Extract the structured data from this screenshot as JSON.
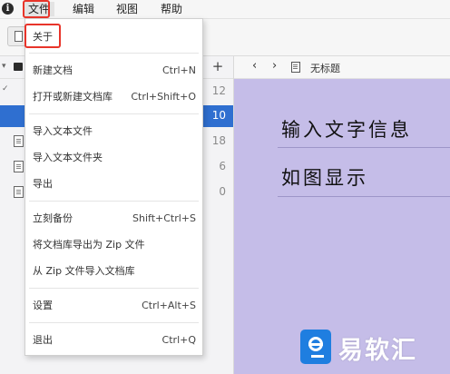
{
  "menubar": {
    "app_icon": "app-logo-icon",
    "items": [
      {
        "label": "文件",
        "active": true
      },
      {
        "label": "编辑",
        "active": false
      },
      {
        "label": "视图",
        "active": false
      },
      {
        "label": "帮助",
        "active": false
      }
    ]
  },
  "file_menu": {
    "items": [
      {
        "label": "关于",
        "shortcut": ""
      },
      {
        "label": "新建文档",
        "shortcut": "Ctrl+N"
      },
      {
        "label": "打开或新建文档库",
        "shortcut": "Ctrl+Shift+O"
      },
      {
        "label": "导入文本文件",
        "shortcut": ""
      },
      {
        "label": "导入文本文件夹",
        "shortcut": ""
      },
      {
        "label": "导出",
        "shortcut": ""
      },
      {
        "label": "立刻备份",
        "shortcut": "Shift+Ctrl+S"
      },
      {
        "label": "将文档库导出为 Zip 文件",
        "shortcut": ""
      },
      {
        "label": "从 Zip 文件导入文档库",
        "shortcut": ""
      },
      {
        "label": "设置",
        "shortcut": "Ctrl+Alt+S"
      },
      {
        "label": "退出",
        "shortcut": "Ctrl+Q"
      }
    ]
  },
  "sidebar": {
    "add_label": "+",
    "counts": [
      "12",
      "10",
      "18",
      "6",
      "0"
    ],
    "selected_index": 1
  },
  "editor": {
    "back_label": "‹",
    "forward_label": "›",
    "title": "无标题",
    "lines": [
      "输入文字信息",
      "如图显示"
    ],
    "background": "#c5bde8"
  },
  "highlight_color": "#e8342a",
  "watermark": {
    "text": "易软汇",
    "logo_color": "#1f7ee0"
  }
}
